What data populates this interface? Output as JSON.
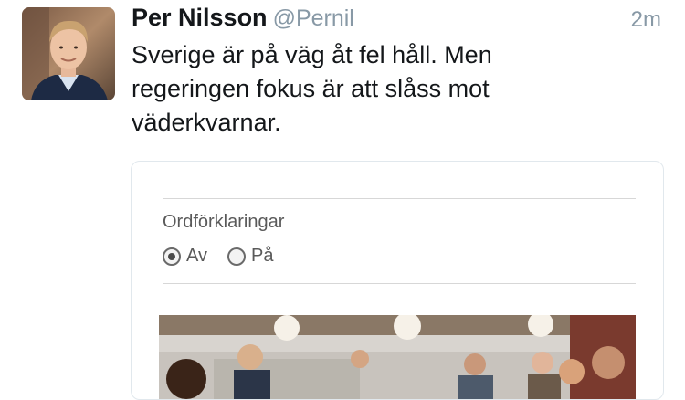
{
  "tweet": {
    "name": "Per Nilsson",
    "handle": "@Pernil",
    "time": "2m",
    "text": "Sverige är på väg åt fel håll. Men regeringen fokus är att slåss mot väderkvarnar."
  },
  "card": {
    "option_label": "Ordförklaringar",
    "options": [
      {
        "label": "Av",
        "selected": true
      },
      {
        "label": "På",
        "selected": false
      }
    ]
  }
}
